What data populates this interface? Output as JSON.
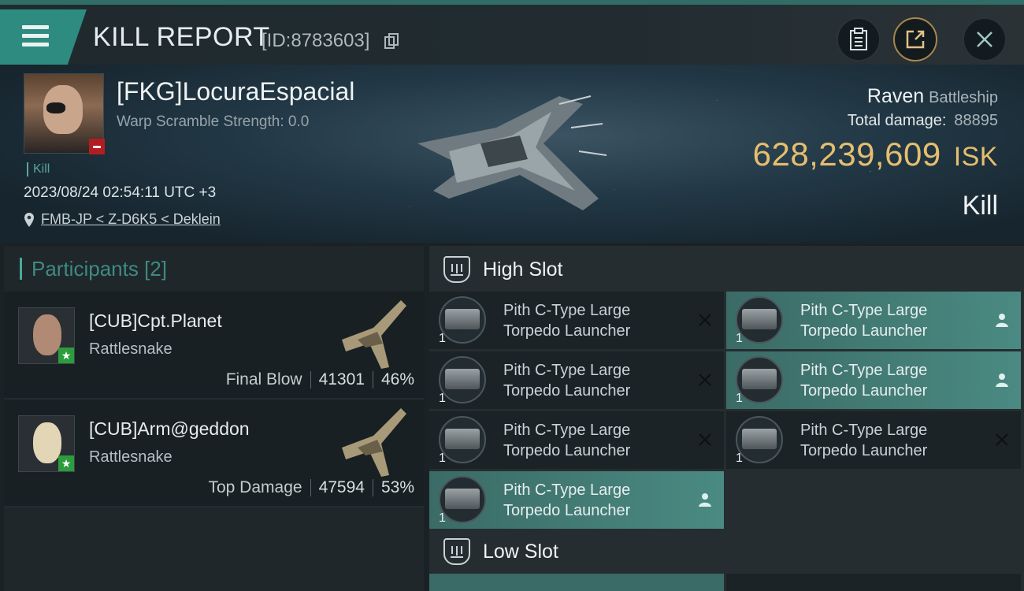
{
  "header": {
    "title": "KILL REPORT",
    "report_id": "[ID:8783603]"
  },
  "victim": {
    "name": "[FKG]LocuraEspacial",
    "warp_scramble": "Warp Scramble Strength: 0.0",
    "kill_tag": "Kill",
    "datetime": "2023/08/24 02:54:11 UTC +3",
    "location": "FMB-JP < Z-D6K5 < Deklein",
    "ship": "Raven",
    "ship_class": "Battleship",
    "total_damage_label": "Total damage:",
    "total_damage": "88895",
    "isk_value": "628,239,609",
    "isk_unit": "ISK",
    "result": "Kill"
  },
  "participants": {
    "title": "Participants [2]",
    "rows": [
      {
        "name": "[CUB]Cpt.Planet",
        "ship": "Rattlesnake",
        "role": "Final Blow",
        "damage": "41301",
        "percent": "46%"
      },
      {
        "name": "[CUB]Arm@geddon",
        "ship": "Rattlesnake",
        "role": "Top Damage",
        "damage": "47594",
        "percent": "53%"
      }
    ]
  },
  "fitting": {
    "high_slot_label": "High Slot",
    "low_slot_label": "Low Slot",
    "modules": [
      {
        "line1": "Pith C-Type Large",
        "line2": "Torpedo Launcher",
        "qty": "1",
        "status": "destroyed-icon"
      },
      {
        "line1": "Pith C-Type Large",
        "line2": "Torpedo Launcher",
        "qty": "1",
        "status": "dropped-icon"
      },
      {
        "line1": "Pith C-Type Large",
        "line2": "Torpedo Launcher",
        "qty": "1",
        "status": "destroyed-icon"
      },
      {
        "line1": "Pith C-Type Large",
        "line2": "Torpedo Launcher",
        "qty": "1",
        "status": "dropped-icon"
      },
      {
        "line1": "Pith C-Type Large",
        "line2": "Torpedo Launcher",
        "qty": "1",
        "status": "destroyed-icon"
      },
      {
        "line1": "Pith C-Type Large",
        "line2": "Torpedo Launcher",
        "qty": "1",
        "status": "destroyed-icon"
      },
      {
        "line1": "Pith C-Type Large",
        "line2": "Torpedo Launcher",
        "qty": "1",
        "status": "dropped-icon"
      }
    ]
  },
  "colors": {
    "accent": "#2e8b80",
    "isk_gold": "#e5be6f",
    "dropped_highlight": "#4a8a82",
    "negative_red": "#b31d22"
  }
}
